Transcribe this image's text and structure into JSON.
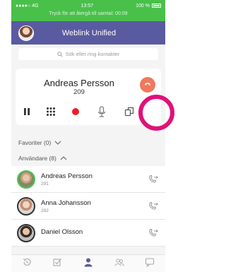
{
  "status": {
    "carrier": "●●●●○ 4G",
    "time": "13:57",
    "battery": "100 %"
  },
  "banner": "Tryck för att återgå till samtal: 00:09",
  "header": {
    "title": "Weblink Unified"
  },
  "search": {
    "placeholder": "Sök eller ring kontakter"
  },
  "call": {
    "name": "Andreas Persson",
    "number": "209"
  },
  "sections": {
    "favorites": "Favoriter (0)",
    "users": "Användare (8)"
  },
  "contacts": [
    {
      "name": "Andreas Persson",
      "number": "291",
      "status": "green"
    },
    {
      "name": "Anna Johansson",
      "number": "292",
      "status": "dark"
    },
    {
      "name": "Daniel  Olsson",
      "number": "",
      "status": "dark"
    }
  ],
  "colors": {
    "header": "#5a5aa0",
    "banner": "#49c04a",
    "highlight": "#e0117a",
    "hangup": "#f0785e",
    "record": "#e8202a"
  }
}
